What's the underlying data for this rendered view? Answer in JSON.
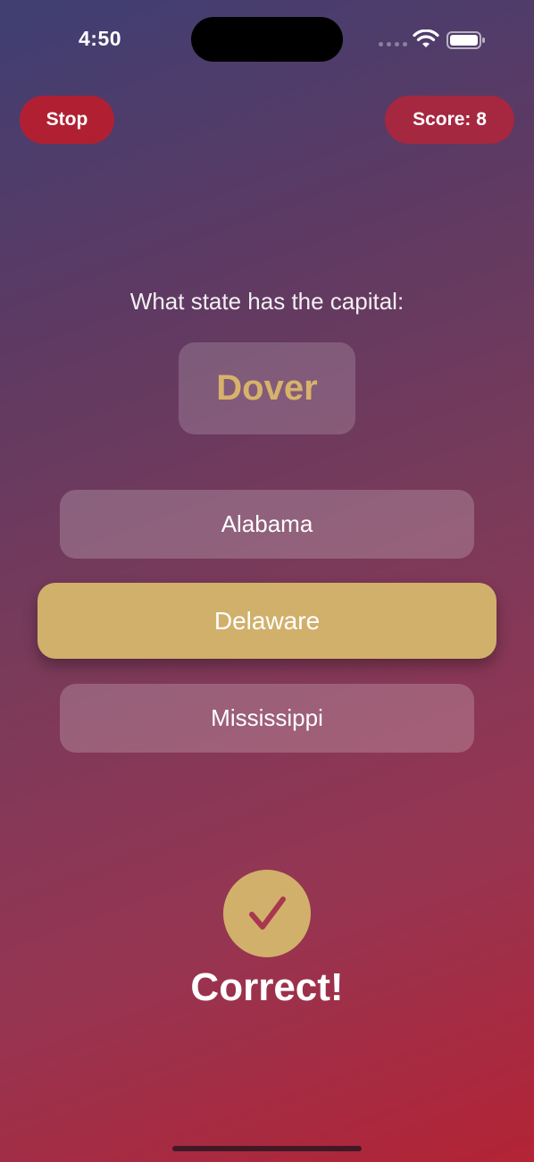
{
  "status_bar": {
    "time": "4:50"
  },
  "top_bar": {
    "stop_label": "Stop",
    "score_label": "Score: 8"
  },
  "question": {
    "prompt": "What state has the capital:",
    "capital": "Dover"
  },
  "answers": [
    {
      "label": "Alabama",
      "selected": false
    },
    {
      "label": "Delaware",
      "selected": true
    },
    {
      "label": "Mississippi",
      "selected": false
    }
  ],
  "result": {
    "text": "Correct!",
    "icon": "checkmark-icon"
  },
  "colors": {
    "accent_gold": "#d1b06b",
    "stop_red": "#b02032",
    "gradient_top": "#3f3f73",
    "gradient_bottom": "#b32335"
  }
}
